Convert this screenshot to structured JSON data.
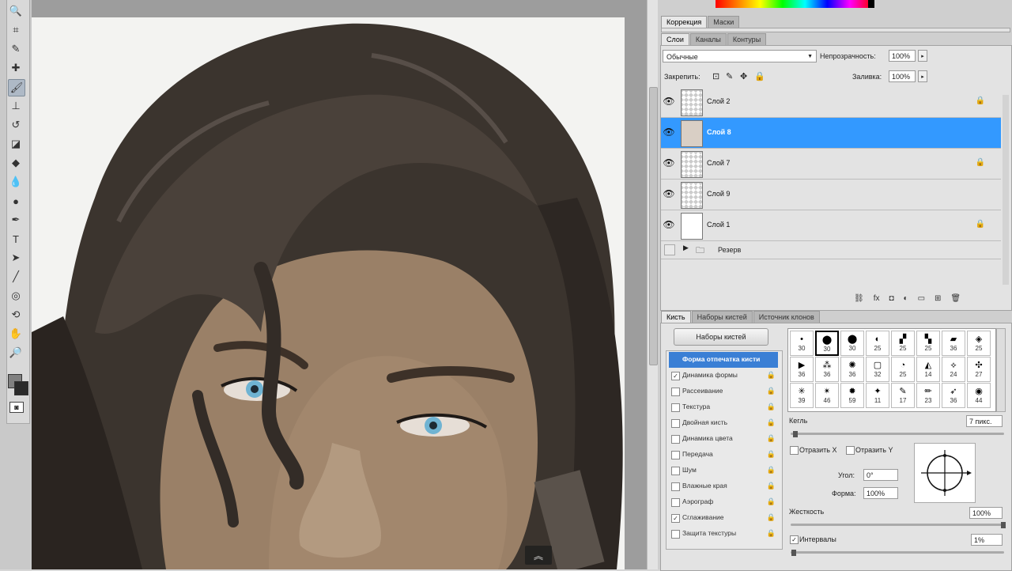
{
  "colors": {
    "selection": "#3399ff",
    "panel_bg": "#e3e3e3",
    "canvas_bg": "#9d9d9d"
  },
  "toolbar": {
    "tools": [
      {
        "icon": "zoom-icon",
        "glyph": "🔍"
      },
      {
        "icon": "crop-icon",
        "glyph": "⌗"
      },
      {
        "icon": "eyedropper-icon",
        "glyph": "✎"
      },
      {
        "icon": "healing-brush-icon",
        "glyph": "✚"
      },
      {
        "icon": "brush-icon",
        "glyph": "🖌",
        "active": true
      },
      {
        "icon": "clone-stamp-icon",
        "glyph": "⊥"
      },
      {
        "icon": "history-brush-icon",
        "glyph": "↺"
      },
      {
        "icon": "eraser-icon",
        "glyph": "◪"
      },
      {
        "icon": "paint-bucket-icon",
        "glyph": "◆"
      },
      {
        "icon": "blur-icon",
        "glyph": "💧"
      },
      {
        "icon": "dodge-icon",
        "glyph": "●"
      },
      {
        "icon": "pen-icon",
        "glyph": "✒"
      },
      {
        "icon": "type-icon",
        "glyph": "T"
      },
      {
        "icon": "path-selection-icon",
        "glyph": "➤"
      },
      {
        "icon": "line-icon",
        "glyph": "╱"
      },
      {
        "icon": "3d-rotate-icon",
        "glyph": "◎"
      },
      {
        "icon": "3d-orbit-icon",
        "glyph": "⟲"
      },
      {
        "icon": "hand-icon",
        "glyph": "✋"
      },
      {
        "icon": "zoom-tool-icon",
        "glyph": "🔎"
      }
    ],
    "quick_mask_icon": "quick-mask-icon"
  },
  "adjust_tabs": [
    "Коррекция",
    "Маски"
  ],
  "layers_panel": {
    "tabs": [
      "Слои",
      "Каналы",
      "Контуры"
    ],
    "blend_mode": "Обычные",
    "opacity_label": "Непрозрачность:",
    "opacity_value": "100%",
    "lock_label": "Закрепить:",
    "fill_label": "Заливка:",
    "fill_value": "100%",
    "layers": [
      {
        "name": "Слой 2",
        "locked": true,
        "selected": false
      },
      {
        "name": "Слой 8",
        "locked": false,
        "selected": true
      },
      {
        "name": "Слой 7",
        "locked": true,
        "selected": false
      },
      {
        "name": "Слой 9",
        "locked": false,
        "selected": false
      },
      {
        "name": "Слой 1",
        "locked": true,
        "selected": false
      }
    ],
    "group_name": "Резерв"
  },
  "brush_panel": {
    "tabs": [
      "Кисть",
      "Наборы кистей",
      "Источник клонов"
    ],
    "presets_button": "Наборы кистей",
    "options": [
      {
        "label": "Форма отпечатка кисти",
        "checked": false,
        "header": true
      },
      {
        "label": "Динамика формы",
        "checked": true
      },
      {
        "label": "Рассеивание",
        "checked": false
      },
      {
        "label": "Текстура",
        "checked": false
      },
      {
        "label": "Двойная кисть",
        "checked": false
      },
      {
        "label": "Динамика цвета",
        "checked": false
      },
      {
        "label": "Передача",
        "checked": false
      },
      {
        "label": "Шум",
        "checked": false
      },
      {
        "label": "Влажные края",
        "checked": false
      },
      {
        "label": "Аэрограф",
        "checked": false
      },
      {
        "label": "Сглаживание",
        "checked": true
      },
      {
        "label": "Защита текстуры",
        "checked": false
      }
    ],
    "preset_sizes": [
      "30",
      "30",
      "30",
      "25",
      "25",
      "25",
      "36",
      "25",
      "36",
      "36",
      "36",
      "32",
      "25",
      "14",
      "24",
      "27",
      "39",
      "46",
      "59",
      "11",
      "17",
      "23",
      "36",
      "44"
    ],
    "size_label": "Кегль",
    "size_value": "7 пикс.",
    "flip_x": "Отразить X",
    "flip_y": "Отразить Y",
    "angle_label": "Угол:",
    "angle_value": "0°",
    "roundness_label": "Форма:",
    "roundness_value": "100%",
    "hardness_label": "Жесткость",
    "hardness_value": "100%",
    "spacing_label": "Интервалы",
    "spacing_value": "1%",
    "spacing_checked": true
  }
}
